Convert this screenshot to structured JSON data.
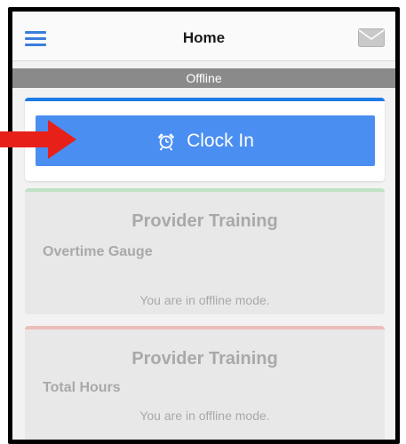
{
  "header": {
    "title": "Home",
    "menu_icon": "hamburger-icon",
    "mail_icon": "mail-icon"
  },
  "status": {
    "offline_text": "Offline"
  },
  "clock": {
    "label": "Clock In",
    "icon": "alarm-clock-icon"
  },
  "cards": [
    {
      "title": "Provider Training",
      "subtitle": "Overtime Gauge",
      "message": "You are in offline mode."
    },
    {
      "title": "Provider Training",
      "subtitle": "Total Hours",
      "message": "You are in offline mode."
    }
  ],
  "colors": {
    "accent": "#4a8ef2",
    "annotation_arrow": "#e8201a"
  }
}
